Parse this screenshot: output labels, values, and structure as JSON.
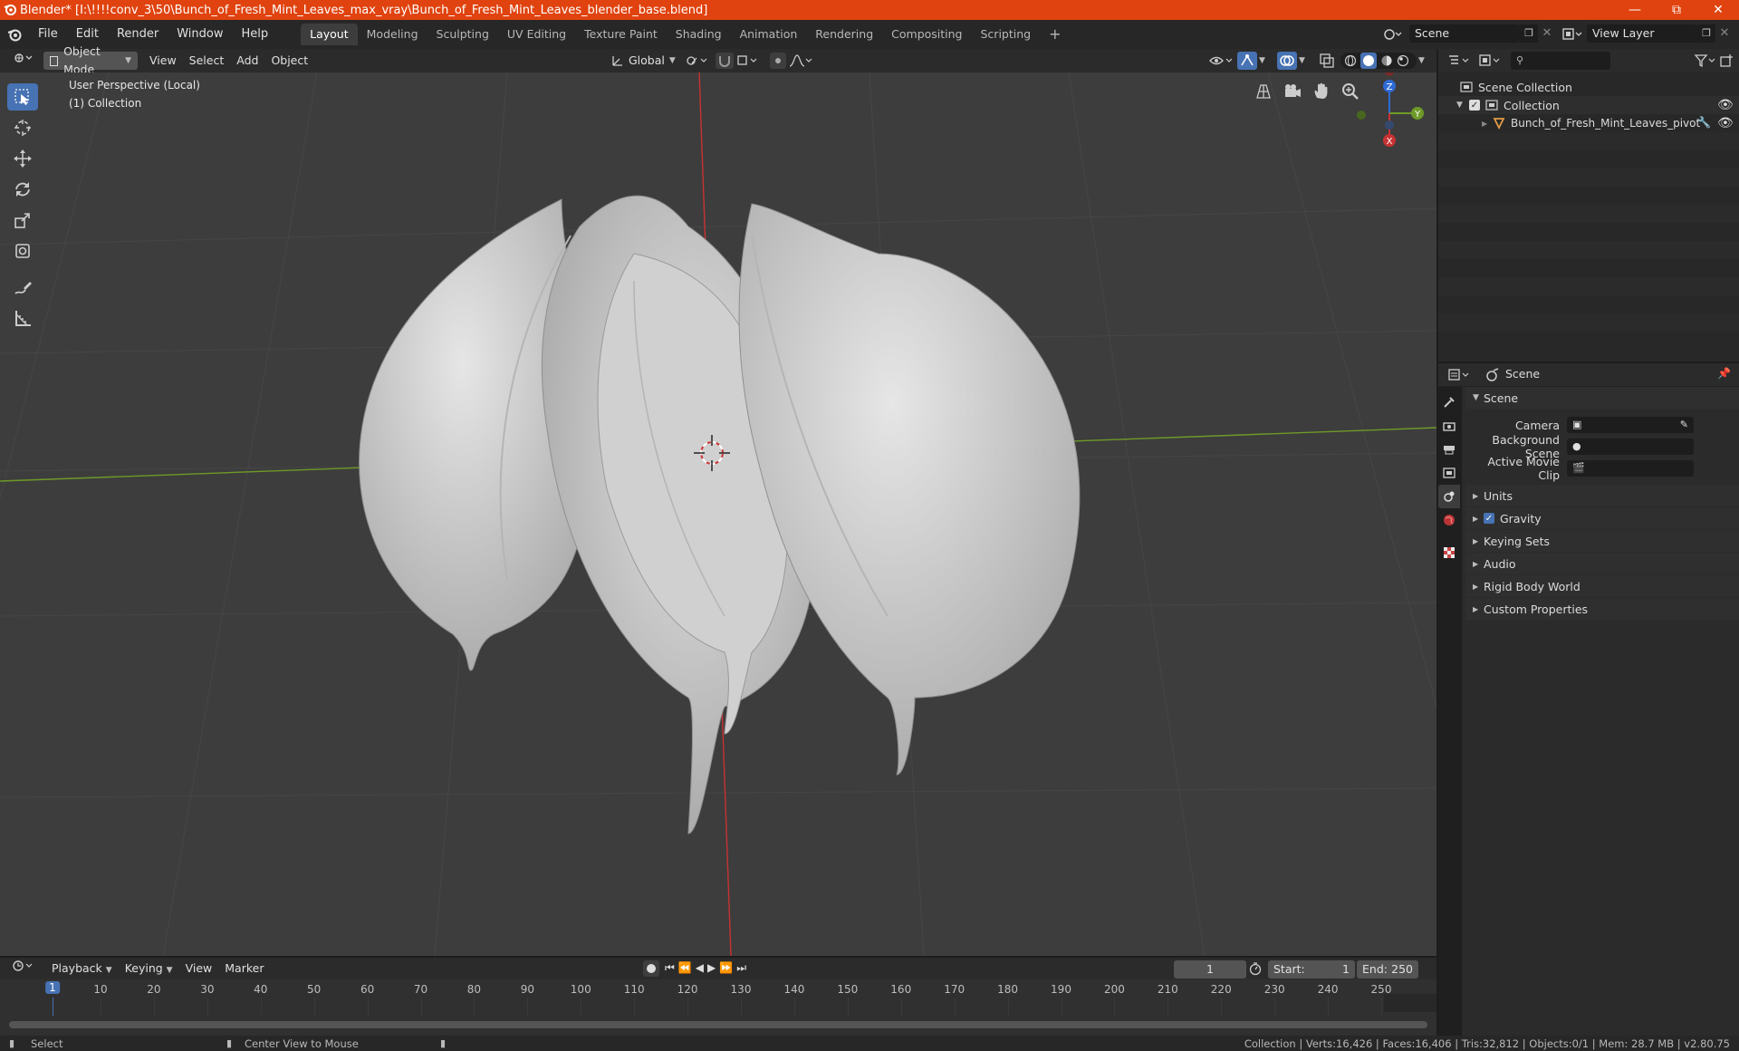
{
  "window": {
    "title": "Blender* [I:\\!!!!conv_3\\50\\Bunch_of_Fresh_Mint_Leaves_max_vray\\Bunch_of_Fresh_Mint_Leaves_blender_base.blend]",
    "controls": [
      "minimize-icon",
      "maximize-icon",
      "close-icon"
    ]
  },
  "menubar": {
    "menus": [
      "File",
      "Edit",
      "Render",
      "Window",
      "Help"
    ],
    "workspaces": [
      "Layout",
      "Modeling",
      "Sculpting",
      "UV Editing",
      "Texture Paint",
      "Shading",
      "Animation",
      "Rendering",
      "Compositing",
      "Scripting"
    ],
    "active_workspace": "Layout",
    "scene_field": "Scene",
    "view_layer_field": "View Layer"
  },
  "viewport_header": {
    "mode": "Object Mode",
    "menus": [
      "View",
      "Select",
      "Add",
      "Object"
    ],
    "transform_orientation": "Global"
  },
  "viewport": {
    "perspective_label": "User Perspective (Local)",
    "collection_label": "(1) Collection",
    "gizmo_axes": [
      "Z",
      "Y",
      "X"
    ],
    "colors": {
      "background": "#3d3d3d",
      "x_axis": "#c83232",
      "y_axis": "#6e9a28",
      "mesh": "#d4d4d4"
    }
  },
  "outliner": {
    "search_placeholder": "",
    "scene_collection": "Scene Collection",
    "collection": "Collection",
    "object": "Bunch_of_Fresh_Mint_Leaves_pivot"
  },
  "properties": {
    "header_title": "Scene",
    "panel_title": "Scene",
    "fields": [
      {
        "label": "Camera",
        "value": ""
      },
      {
        "label": "Background Scene",
        "value": ""
      },
      {
        "label": "Active Movie Clip",
        "value": ""
      }
    ],
    "subpanels": [
      "Units",
      "Gravity",
      "Keying Sets",
      "Audio",
      "Rigid Body World",
      "Custom Properties"
    ],
    "gravity_enabled": true
  },
  "timeline": {
    "menus": [
      "Playback",
      "Keying",
      "View",
      "Marker"
    ],
    "current_frame": "1",
    "start_label": "Start:",
    "start": "1",
    "end_label": "End:",
    "end": "250",
    "ruler": [
      "1",
      "10",
      "20",
      "30",
      "40",
      "50",
      "60",
      "70",
      "80",
      "90",
      "100",
      "110",
      "120",
      "130",
      "140",
      "150",
      "160",
      "170",
      "180",
      "190",
      "200",
      "210",
      "220",
      "230",
      "240",
      "250"
    ]
  },
  "statusbar": {
    "left_action": "Select",
    "middle_action": "Center View to Mouse",
    "stats": "Collection | Verts:16,426 | Faces:16,406 | Tris:32,812 | Objects:0/1 | Mem: 28.7 MB | v2.80.75"
  }
}
